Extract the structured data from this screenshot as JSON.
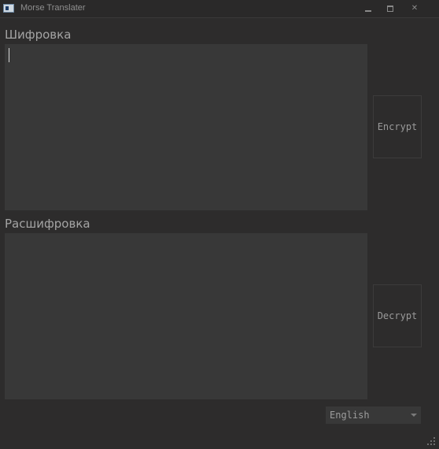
{
  "window": {
    "title": "Morse Translater",
    "icon": "app-window-icon",
    "controls": [
      "minimize-icon",
      "maximize-icon",
      "close-icon"
    ]
  },
  "encrypt": {
    "label": "Шифровка",
    "input_value": "",
    "button_label": "Encrypt"
  },
  "decrypt": {
    "label": "Расшифровка",
    "input_value": "",
    "button_label": "Decrypt"
  },
  "language": {
    "selected": "English"
  },
  "colors": {
    "background": "#2d2c2c",
    "input_background": "#383838",
    "text": "#a4a4a4"
  }
}
